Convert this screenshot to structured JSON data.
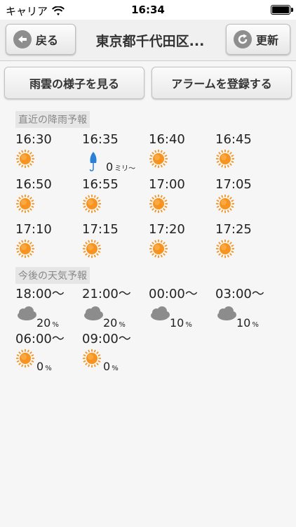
{
  "status_bar": {
    "carrier": "キャリア",
    "time": "16:34"
  },
  "nav": {
    "back_label": "戻る",
    "title": "東京都千代田区...",
    "refresh_label": "更新"
  },
  "actions": {
    "rain_cloud": "雨雲の様子を見る",
    "register_alarm": "アラームを登録する"
  },
  "rain_forecast": {
    "label": "直近の降雨予報",
    "items": [
      {
        "time": "16:30",
        "icon": "sun-icon"
      },
      {
        "time": "16:35",
        "icon": "umbrella-icon",
        "amount": "0",
        "unit": "ミリ～"
      },
      {
        "time": "16:40",
        "icon": "sun-icon"
      },
      {
        "time": "16:45",
        "icon": "sun-icon"
      },
      {
        "time": "16:50",
        "icon": "sun-icon"
      },
      {
        "time": "16:55",
        "icon": "sun-icon"
      },
      {
        "time": "17:00",
        "icon": "sun-icon"
      },
      {
        "time": "17:05",
        "icon": "sun-icon"
      },
      {
        "time": "17:10",
        "icon": "sun-icon"
      },
      {
        "time": "17:15",
        "icon": "sun-icon"
      },
      {
        "time": "17:20",
        "icon": "sun-icon"
      },
      {
        "time": "17:25",
        "icon": "sun-icon"
      }
    ]
  },
  "weather_forecast": {
    "label": "今後の天気予報",
    "items": [
      {
        "time": "18:00～",
        "icon": "cloud-icon",
        "percent": "20",
        "unit": "%"
      },
      {
        "time": "21:00～",
        "icon": "cloud-icon",
        "percent": "20",
        "unit": "%"
      },
      {
        "time": "00:00～",
        "icon": "cloud-icon",
        "percent": "10",
        "unit": "%"
      },
      {
        "time": "03:00～",
        "icon": "cloud-icon",
        "percent": "10",
        "unit": "%"
      },
      {
        "time": "06:00～",
        "icon": "sun-icon",
        "percent": "0",
        "unit": "%"
      },
      {
        "time": "09:00～",
        "icon": "sun-icon",
        "percent": "0",
        "unit": "%"
      }
    ]
  },
  "colors": {
    "sun": "#f7931e",
    "cloud": "#8c8c8c",
    "umbrella": "#2b7fd6"
  }
}
